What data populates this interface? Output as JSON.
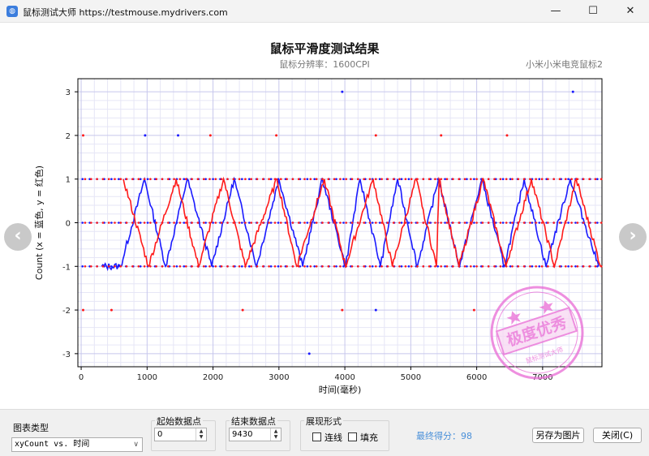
{
  "window": {
    "title": "鼠标测试大师 https://testmouse.mydrivers.com",
    "minimize_glyph": "—",
    "maximize_glyph": "☐",
    "close_glyph": "✕"
  },
  "header": {
    "title": "鼠标平滑度测试结果",
    "subtitle": "鼠标分辨率：1600CPI",
    "mouse_name": "小米小米电竞鼠标2"
  },
  "nav": {
    "prev": "‹",
    "next": "›"
  },
  "stamp": {
    "text": "极度优秀",
    "ring_text": "鼠标测试大师"
  },
  "controls": {
    "chart_type_label": "图表类型",
    "chart_type_value": "xyCount vs. 时间",
    "start_point_label": "起始数据点",
    "start_point_value": "0",
    "end_point_label": "结束数据点",
    "end_point_value": "9430",
    "display_label": "展现形式",
    "lines_label": "连线",
    "fill_label": "填充",
    "lines_checked": false,
    "fill_checked": false,
    "score_text": "最终得分：98",
    "save_image_label": "另存为图片",
    "close_label": "关闭(C)"
  },
  "chart_data": {
    "type": "line",
    "xlabel": "时间(毫秒)",
    "ylabel": "Count (x = 蓝色, y = 红色)",
    "xlim": [
      -50,
      7900
    ],
    "ylim": [
      -3.3,
      3.3
    ],
    "xticks": [
      0,
      1000,
      2000,
      3000,
      4000,
      5000,
      6000,
      7000
    ],
    "yticks": [
      -3,
      -2,
      -1,
      0,
      1,
      2,
      3
    ],
    "grid": true,
    "legend": "none",
    "colors": {
      "x": "#1a1aff",
      "y": "#ff1a1a"
    },
    "series": [
      {
        "axis": "x",
        "peaks": [
          960,
          1610,
          2320,
          3000,
          3660,
          4230,
          4800,
          5420,
          6080,
          6720,
          7420
        ],
        "troughs": [
          310,
          600,
          1280,
          1980,
          2660,
          3360,
          4010,
          4540,
          5100,
          5740,
          6420,
          7050,
          7850
        ],
        "outliers": [
          [
            970,
            2
          ],
          [
            1470,
            2
          ],
          [
            3460,
            -3
          ],
          [
            3960,
            3
          ],
          [
            4470,
            -2
          ],
          [
            7460,
            3
          ]
        ]
      },
      {
        "axis": "y",
        "peaks": [
          640,
          1440,
          2160,
          2970,
          3690,
          4430,
          5080,
          5430,
          6100,
          6830,
          7510
        ],
        "troughs": [
          1020,
          1780,
          2490,
          3270,
          4010,
          4720,
          5390,
          5730,
          6440,
          7180,
          7880
        ],
        "outliers": [
          [
            30,
            2
          ],
          [
            30,
            -2
          ],
          [
            460,
            -2
          ],
          [
            1960,
            2
          ],
          [
            2450,
            -2
          ],
          [
            2960,
            2
          ],
          [
            3960,
            -2
          ],
          [
            4470,
            2
          ],
          [
            5460,
            2
          ],
          [
            5960,
            -2
          ],
          [
            6460,
            2
          ]
        ]
      }
    ]
  }
}
